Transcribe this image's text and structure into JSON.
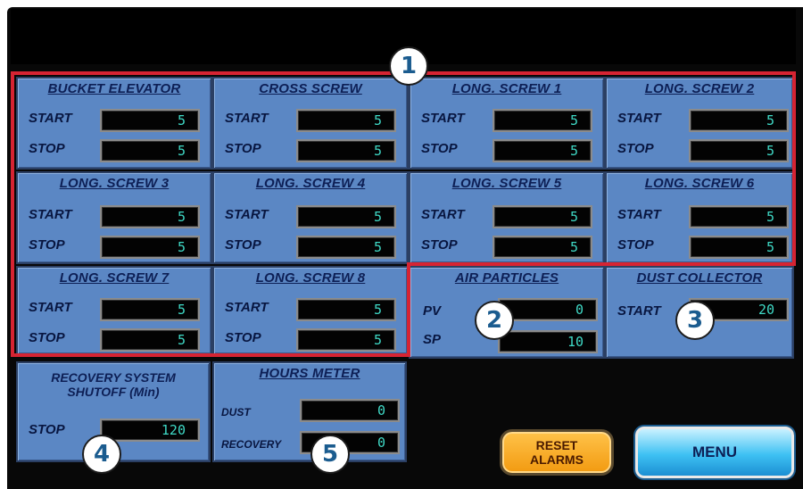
{
  "panels": {
    "bucket_elevator": {
      "title": "BUCKET ELEVATOR",
      "start_label": "START",
      "stop_label": "STOP",
      "start": "5",
      "stop": "5"
    },
    "cross_screw": {
      "title": "CROSS SCREW",
      "start_label": "START",
      "stop_label": "STOP",
      "start": "5",
      "stop": "5"
    },
    "long_screw_1": {
      "title": "LONG. SCREW 1",
      "start_label": "START",
      "stop_label": "STOP",
      "start": "5",
      "stop": "5"
    },
    "long_screw_2": {
      "title": "LONG. SCREW 2",
      "start_label": "START",
      "stop_label": "STOP",
      "start": "5",
      "stop": "5"
    },
    "long_screw_3": {
      "title": "LONG. SCREW 3",
      "start_label": "START",
      "stop_label": "STOP",
      "start": "5",
      "stop": "5"
    },
    "long_screw_4": {
      "title": "LONG. SCREW 4",
      "start_label": "START",
      "stop_label": "STOP",
      "start": "5",
      "stop": "5"
    },
    "long_screw_5": {
      "title": "LONG. SCREW 5",
      "start_label": "START",
      "stop_label": "STOP",
      "start": "5",
      "stop": "5"
    },
    "long_screw_6": {
      "title": "LONG. SCREW 6",
      "start_label": "START",
      "stop_label": "STOP",
      "start": "5",
      "stop": "5"
    },
    "long_screw_7": {
      "title": "LONG. SCREW 7",
      "start_label": "START",
      "stop_label": "STOP",
      "start": "5",
      "stop": "5"
    },
    "long_screw_8": {
      "title": "LONG. SCREW 8",
      "start_label": "START",
      "stop_label": "STOP",
      "start": "5",
      "stop": "5"
    },
    "air_particles": {
      "title": "AIR PARTICLES",
      "pv_label": "PV",
      "sp_label": "SP",
      "pv": "0",
      "sp": "10"
    },
    "dust_collector": {
      "title": "DUST COLLECTOR",
      "start_label": "START",
      "start": "20"
    },
    "recovery_system": {
      "title_line1": "RECOVERY SYSTEM",
      "title_line2": "SHUTOFF (Min)",
      "stop_label": "STOP",
      "stop": "120"
    },
    "hours_meter": {
      "title": "HOURS METER",
      "dust_label": "DUST",
      "recovery_label": "RECOVERY",
      "dust": "0",
      "recovery": "0"
    }
  },
  "buttons": {
    "reset_line1": "RESET",
    "reset_line2": "ALARMS",
    "menu": "MENU"
  },
  "callouts": [
    "1",
    "2",
    "3",
    "4",
    "5"
  ],
  "colors": {
    "panel": "#5b87c4",
    "title_text": "#0d1f55",
    "display_text": "#3fd9c6",
    "highlight": "#d62433",
    "reset": "#f29a10",
    "menu": "#3ec1f3"
  }
}
